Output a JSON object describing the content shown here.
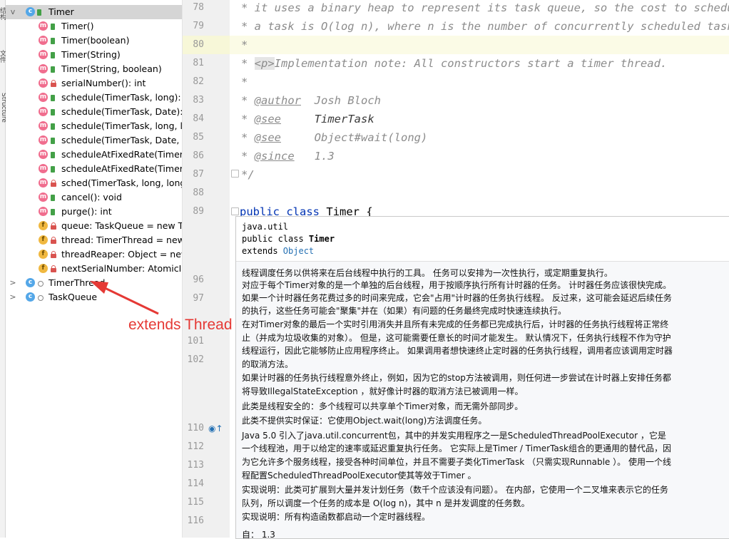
{
  "sidebar_strip": {
    "labels": [
      "结构",
      "文件",
      "Structure"
    ]
  },
  "structure": {
    "root": {
      "label": "Timer",
      "icon": "class-icon",
      "expand": "v"
    },
    "members": [
      {
        "kind": "m",
        "vis": "pub",
        "label": "Timer()"
      },
      {
        "kind": "m",
        "vis": "pub",
        "label": "Timer(boolean)"
      },
      {
        "kind": "m",
        "vis": "pub",
        "label": "Timer(String)"
      },
      {
        "kind": "m",
        "vis": "pub",
        "label": "Timer(String, boolean)"
      },
      {
        "kind": "m",
        "vis": "priv",
        "label": "serialNumber(): int"
      },
      {
        "kind": "m",
        "vis": "pub",
        "label": "schedule(TimerTask, long): vo"
      },
      {
        "kind": "m",
        "vis": "pub",
        "label": "schedule(TimerTask, Date): vo"
      },
      {
        "kind": "m",
        "vis": "pub",
        "label": "schedule(TimerTask, long, lon"
      },
      {
        "kind": "m",
        "vis": "pub",
        "label": "schedule(TimerTask, Date, lon"
      },
      {
        "kind": "m",
        "vis": "pub",
        "label": "scheduleAtFixedRate(TimerTa"
      },
      {
        "kind": "m",
        "vis": "pub",
        "label": "scheduleAtFixedRate(TimerTa"
      },
      {
        "kind": "m",
        "vis": "priv",
        "label": "sched(TimerTask, long, long)"
      },
      {
        "kind": "m",
        "vis": "pub",
        "label": "cancel(): void"
      },
      {
        "kind": "m",
        "vis": "pub",
        "label": "purge(): int"
      },
      {
        "kind": "f",
        "vis": "priv",
        "label": "queue: TaskQueue = new Tas"
      },
      {
        "kind": "f",
        "vis": "priv",
        "label": "thread: TimerThread = new T"
      },
      {
        "kind": "f",
        "vis": "priv",
        "label": "threadReaper: Object = new"
      },
      {
        "kind": "f",
        "vis": "priv",
        "label": "nextSerialNumber: AtomicInte"
      }
    ],
    "others": [
      {
        "label": "TimerThread",
        "expand": ">"
      },
      {
        "label": "TaskQueue",
        "expand": ">"
      }
    ]
  },
  "annotation": {
    "text": "extends Thread"
  },
  "editor": {
    "line_numbers": [
      "78",
      "79",
      "80",
      "81",
      "82",
      "83",
      "84",
      "85",
      "86",
      "87",
      "88",
      "89",
      "96",
      "97",
      "101",
      "102",
      "110",
      "112",
      "113",
      "114",
      "115",
      "116"
    ],
    "lines": {
      "l78": "* it uses a binary heap to represent its task queue, so the cost to schedule",
      "l79": "* a task is O(log n), where n is the number of concurrently scheduled tasks",
      "l80": "*",
      "l81_pre": "* ",
      "l81_tag": "<p>",
      "l81_post": "Implementation note: All constructors start a timer thread.",
      "l82": "*",
      "l83_tag": "@author",
      "l83_val": "Josh Bloch",
      "l84_tag": "@see",
      "l84_val": "TimerTask",
      "l85_tag": "@see",
      "l85_val": "Object#wait(long)",
      "l86_tag": "@since",
      "l86_val": "1.3",
      "l87": "*/",
      "l89_kw1": "public",
      "l89_kw2": "class",
      "l89_name": "Timer {"
    }
  },
  "doc_popup": {
    "package": "java.util",
    "decl_prefix": "public class ",
    "decl_name": "Timer",
    "extends_prefix": "extends ",
    "extends_link": "Object",
    "paragraphs": [
      "线程调度任务以供将来在后台线程中执行的工具。 任务可以安排为一次性执行，或定期重复执行。",
      "对应于每个Timer对象的是一个单独的后台线程，用于按顺序执行所有计时器的任务。 计时器任务应该很快完成。",
      "如果一个计时器任务花费过多的时间来完成，它会\"占用\"计时器的任务执行线程。 反过来，这可能会延迟后续任务",
      "的执行，这些任务可能会\"聚集\"并在（如果）有问题的任务最终完成时快速连续执行。",
      "在对Timer对象的最后一个实时引用消失并且所有未完成的任务都已完成执行后，计时器的任务执行线程将正常终",
      "止（并成为垃圾收集的对象）。 但是，这可能需要任意长的时间才能发生。 默认情况下，任务执行线程不作为守护",
      "线程运行，因此它能够防止应用程序终止。 如果调用者想快速终止定时器的任务执行线程，调用者应该调用定时器",
      "的取消方法。",
      "如果计时器的任务执行线程意外终止，例如，因为它的stop方法被调用，则任何进一步尝试在计时器上安排任务都",
      "将导致IllegalStateException ，就好像计时器的取消方法已被调用一样。",
      "此类是线程安全的：多个线程可以共享单个Timer对象，而无需外部同步。",
      "此类不提供实时保证：它使用Object.wait(long)方法调度任务。",
      "Java 5.0 引入了java.util.concurrent包，其中的并发实用程序之一是ScheduledThreadPoolExecutor ，它是",
      "一个线程池，用于以给定的速率或延迟重复执行任务。 它实际上是Timer / TimerTask组合的更通用的替代品，因",
      "为它允许多个服务线程，接受各种时间单位，并且不需要子类化TimerTask （只需实现Runnable ）。 使用一个线",
      "程配置ScheduledThreadPoolExecutor使其等效于Timer 。",
      "实现说明：此类可扩展到大量并发计划任务（数千个应该没有问题）。 在内部，它使用一个二叉堆来表示它的任务",
      "队列，所以调度一个任务的成本是 O(log n)，其中 n 是并发调度的任务数。",
      "实现说明：所有构造函数都启动一个定时器线程。",
      "自：      1.3"
    ]
  },
  "colors": {
    "annotation_red": "#e53935",
    "link_blue": "#2470b3",
    "keyword_blue": "#0033b3"
  }
}
